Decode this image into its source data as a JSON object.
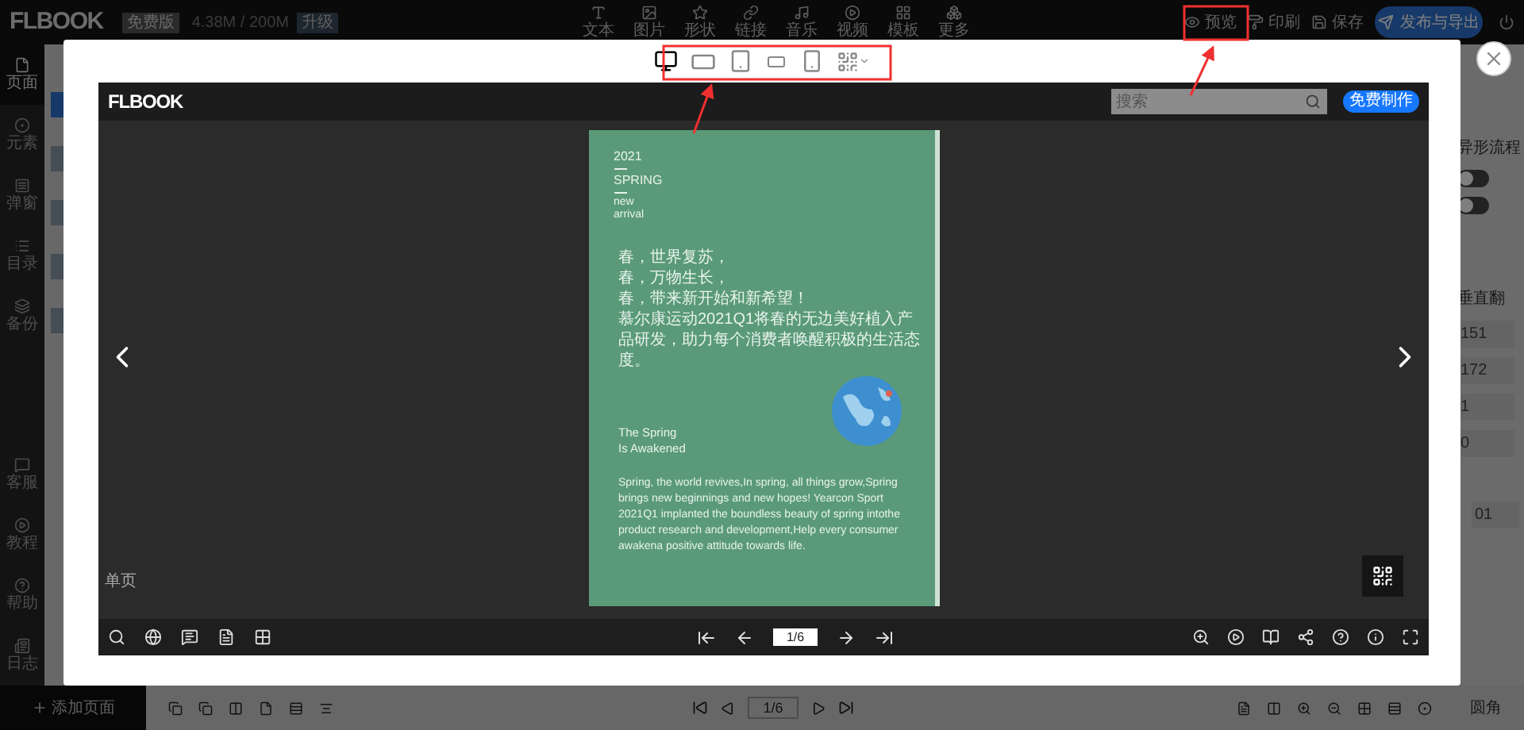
{
  "topbar": {
    "logo": "FLBOOK",
    "plan": "免费版",
    "storage": "4.38M / 200M",
    "upgrade": "升级",
    "tools": [
      {
        "label": "文本"
      },
      {
        "label": "图片"
      },
      {
        "label": "形状"
      },
      {
        "label": "链接"
      },
      {
        "label": "音乐"
      },
      {
        "label": "视频"
      },
      {
        "label": "模板"
      },
      {
        "label": "更多"
      }
    ],
    "actions": [
      {
        "label": "预览"
      },
      {
        "label": "印刷"
      },
      {
        "label": "保存"
      }
    ],
    "publish": "发布与导出"
  },
  "sidebar": {
    "items": [
      {
        "label": "页面",
        "selected": true
      },
      {
        "label": "元素",
        "selected": false
      },
      {
        "label": "弹窗",
        "selected": false
      },
      {
        "label": "目录",
        "selected": false
      },
      {
        "label": "备份",
        "selected": false
      }
    ],
    "bottom_items": [
      {
        "label": "客服"
      },
      {
        "label": "教程"
      },
      {
        "label": "帮助"
      },
      {
        "label": "日志"
      }
    ]
  },
  "right_panel": {
    "heading": "异形流程",
    "toggles": [
      {
        "on": false
      },
      {
        "on": false
      }
    ],
    "label": "垂直翻",
    "values": [
      "151",
      "172",
      "1",
      "0"
    ],
    "extra_value": "01"
  },
  "bottom_bar": {
    "add_page": "添加页面",
    "page": "1/6",
    "corner": "圆角"
  },
  "preview": {
    "devices": [
      {
        "kind": "desktop",
        "selected": true
      },
      {
        "kind": "tablet-landscape",
        "selected": false
      },
      {
        "kind": "tablet",
        "selected": false
      },
      {
        "kind": "phone-landscape",
        "selected": false
      },
      {
        "kind": "phone",
        "selected": false
      },
      {
        "kind": "qr",
        "selected": false
      }
    ],
    "viewer": {
      "logo": "FLBOOK",
      "search_placeholder": "搜索",
      "cta": "免费制作",
      "mode": "单页",
      "page": "1/6",
      "book_page": {
        "year": "2021",
        "season": "SPRING",
        "tagline": [
          "new",
          "arrival"
        ],
        "cn_lines": [
          "春，世界复苏，",
          "春，万物生长，",
          "春，带来新开始和新希望！",
          "慕尔康运动2021Q1将春的无边美好植入产品研发，助力每个消费者唤醒积极的生活态度。"
        ],
        "en_title": [
          "The Spring",
          "Is Awakened"
        ],
        "en_body": "Spring, the world revives,In spring, all things grow,Spring brings new beginnings and new hopes! Yearcon Sport 2021Q1 implanted the boundless beauty of spring intothe product research and development,Help every consumer awakena positive attitude towards life."
      }
    }
  }
}
